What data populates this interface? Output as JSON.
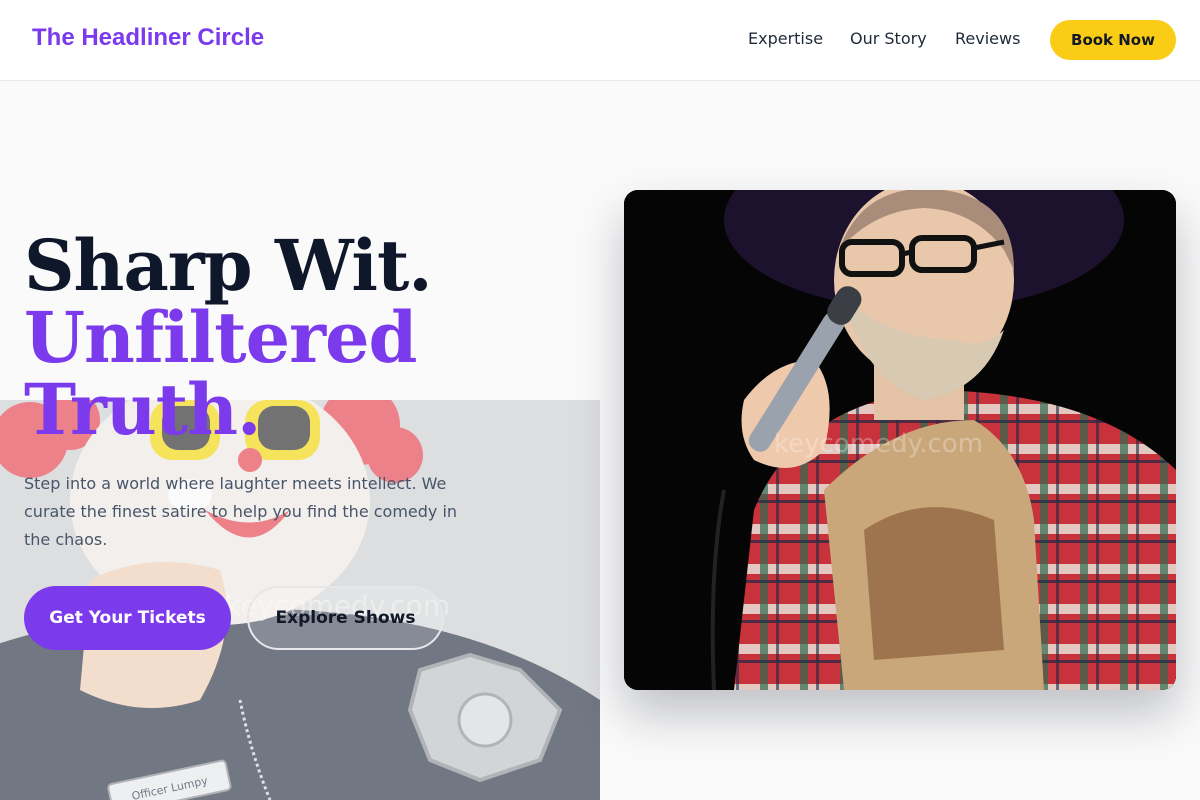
{
  "header": {
    "brand": "The Headliner Circle",
    "nav": [
      {
        "label": "Expertise"
      },
      {
        "label": "Our Story"
      },
      {
        "label": "Reviews"
      }
    ],
    "cta_label": "Book Now"
  },
  "hero": {
    "title_line1": "Sharp Wit.",
    "title_line2": "Unfiltered",
    "title_line3": "Truth.",
    "description": "Step into a world where laughter meets intellect. We curate the finest satire to help you find the comedy in the chaos.",
    "primary_cta": "Get Your Tickets",
    "secondary_cta": "Explore Shows"
  },
  "images": {
    "background_watermark": "keycomedy.com",
    "badge_text": "Officer Lumpy",
    "card_watermark": "keycomedy.com"
  },
  "colors": {
    "brand_purple": "#7c3aed",
    "accent_yellow": "#facc15",
    "heading_dark": "#0f172a",
    "body_gray": "#475569"
  }
}
